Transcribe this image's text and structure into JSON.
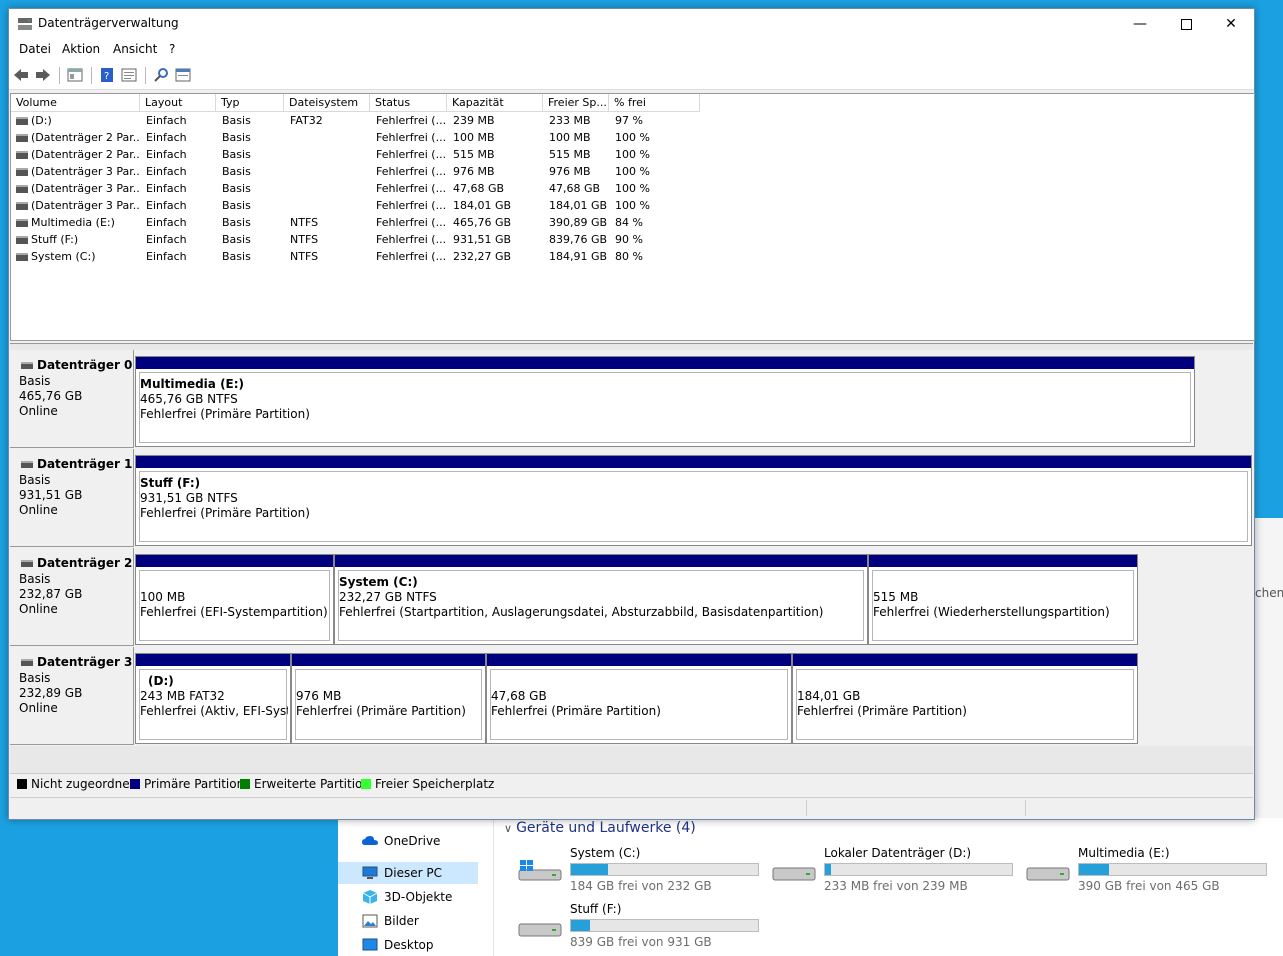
{
  "window": {
    "title": "Datenträgerverwaltung"
  },
  "menu": [
    "Datei",
    "Aktion",
    "Ansicht",
    "?"
  ],
  "columns": [
    "Volume",
    "Layout",
    "Typ",
    "Dateisystem",
    "Status",
    "Kapazität",
    "Freier Sp...",
    "% frei"
  ],
  "volumes": [
    [
      "(D:)",
      "Einfach",
      "Basis",
      "FAT32",
      "Fehlerfrei (...",
      "239 MB",
      "233 MB",
      "97 %"
    ],
    [
      "(Datenträger 2 Par...",
      "Einfach",
      "Basis",
      "",
      "Fehlerfrei (...",
      "100 MB",
      "100 MB",
      "100 %"
    ],
    [
      "(Datenträger 2 Par...",
      "Einfach",
      "Basis",
      "",
      "Fehlerfrei (...",
      "515 MB",
      "515 MB",
      "100 %"
    ],
    [
      "(Datenträger 3 Par...",
      "Einfach",
      "Basis",
      "",
      "Fehlerfrei (...",
      "976 MB",
      "976 MB",
      "100 %"
    ],
    [
      "(Datenträger 3 Par...",
      "Einfach",
      "Basis",
      "",
      "Fehlerfrei (...",
      "47,68 GB",
      "47,68 GB",
      "100 %"
    ],
    [
      "(Datenträger 3 Par...",
      "Einfach",
      "Basis",
      "",
      "Fehlerfrei (...",
      "184,01 GB",
      "184,01 GB",
      "100 %"
    ],
    [
      "Multimedia (E:)",
      "Einfach",
      "Basis",
      "NTFS",
      "Fehlerfrei (...",
      "465,76 GB",
      "390,89 GB",
      "84 %"
    ],
    [
      "Stuff (F:)",
      "Einfach",
      "Basis",
      "NTFS",
      "Fehlerfrei (...",
      "931,51 GB",
      "839,76 GB",
      "90 %"
    ],
    [
      "System (C:)",
      "Einfach",
      "Basis",
      "NTFS",
      "Fehlerfrei (...",
      "232,27 GB",
      "184,91 GB",
      "80 %"
    ]
  ],
  "disks": [
    {
      "name": "Datenträger 0",
      "type": "Basis",
      "size": "465,76 GB",
      "state": "Online",
      "partitions": [
        {
          "title": "Multimedia  (E:)",
          "line2": "465,76 GB NTFS",
          "line3": "Fehlerfrei (Primäre Partition)"
        }
      ]
    },
    {
      "name": "Datenträger 1",
      "type": "Basis",
      "size": "931,51 GB",
      "state": "Online",
      "partitions": [
        {
          "title": "Stuff  (F:)",
          "line2": "931,51 GB NTFS",
          "line3": "Fehlerfrei (Primäre Partition)"
        }
      ]
    },
    {
      "name": "Datenträger 2",
      "type": "Basis",
      "size": "232,87 GB",
      "state": "Online",
      "partitions": [
        {
          "title": "",
          "line2": "100 MB",
          "line3": "Fehlerfrei (EFI-Systempartition)"
        },
        {
          "title": "System  (C:)",
          "line2": "232,27 GB NTFS",
          "line3": "Fehlerfrei (Startpartition, Auslagerungsdatei, Absturzabbild, Basisdatenpartition)"
        },
        {
          "title": "",
          "line2": "515 MB",
          "line3": "Fehlerfrei (Wiederherstellungspartition)"
        }
      ]
    },
    {
      "name": "Datenträger 3",
      "type": "Basis",
      "size": "232,89 GB",
      "state": "Online",
      "partitions": [
        {
          "title": "(D:)",
          "line2": "243 MB FAT32",
          "line3": "Fehlerfrei (Aktiv, EFI-Systen"
        },
        {
          "title": "",
          "line2": "976 MB",
          "line3": "Fehlerfrei (Primäre Partition)"
        },
        {
          "title": "",
          "line2": "47,68 GB",
          "line3": "Fehlerfrei (Primäre Partition)"
        },
        {
          "title": "",
          "line2": "184,01 GB",
          "line3": "Fehlerfrei (Primäre Partition)"
        }
      ]
    }
  ],
  "legend": [
    {
      "label": "Nicht zugeordnet",
      "color": "#000000"
    },
    {
      "label": "Primäre Partition",
      "color": "#00007f"
    },
    {
      "label": "Erweiterte Partition",
      "color": "#008000"
    },
    {
      "label": "Freier Speicherplatz",
      "color": "#33ff33"
    }
  ],
  "explorer": {
    "nav": [
      "OneDrive",
      "Dieser PC",
      "3D-Objekte",
      "Bilder",
      "Desktop"
    ],
    "group": "Geräte und Laufwerke (4)",
    "edge_text": "chen",
    "drives": [
      {
        "name": "System (C:)",
        "free": "184 GB frei von 232 GB",
        "used_fraction": 0.2
      },
      {
        "name": "Lokaler Datenträger (D:)",
        "free": "233 MB frei von 239 MB",
        "used_fraction": 0.03
      },
      {
        "name": "Multimedia (E:)",
        "free": "390 GB frei von 465 GB",
        "used_fraction": 0.16
      },
      {
        "name": "Stuff (F:)",
        "free": "839 GB frei von 931 GB",
        "used_fraction": 0.1
      }
    ]
  }
}
